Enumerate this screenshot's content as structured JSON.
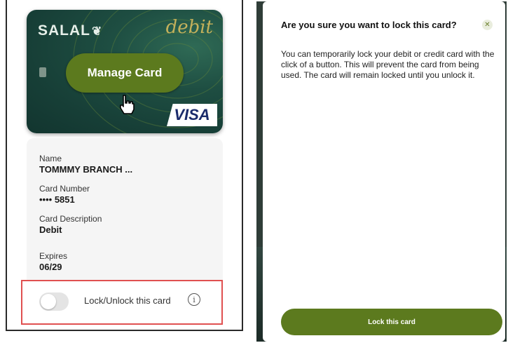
{
  "card": {
    "brand": "SALAL",
    "type_label": "debit",
    "manage_button": "Manage Card",
    "network": "VISA"
  },
  "details": {
    "name_label": "Name",
    "name_value": "TOMMMY BRANCH ...",
    "number_label": "Card Number",
    "number_value": "•••• 5851",
    "description_label": "Card Description",
    "description_value": "Debit",
    "expires_label": "Expires",
    "expires_value": "06/29"
  },
  "lock_toggle": {
    "label": "Lock/Unlock this card",
    "checked": false
  },
  "dialog": {
    "title": "Are you sure you want to lock this card?",
    "body": "You can temporarily lock your debit or credit card with the click of a button. This will prevent the card from being used. The card will remain locked until you unlock it.",
    "confirm_button": "Lock this card"
  },
  "colors": {
    "accent_green": "#5c7a1e",
    "card_teal": "#1e4e42",
    "highlight_red": "#e05050"
  },
  "icons": {
    "close": "close-icon",
    "info": "info-icon",
    "cursor": "hand-cursor-icon"
  }
}
